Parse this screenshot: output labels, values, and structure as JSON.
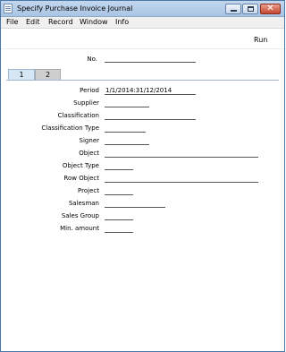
{
  "window": {
    "title": "Specify Purchase Invoice Journal"
  },
  "menu": [
    "File",
    "Edit",
    "Record",
    "Window",
    "Info"
  ],
  "toolbar": {
    "run_label": "Run"
  },
  "header": {
    "no_label": "No.",
    "no_value": ""
  },
  "tabs": [
    "1",
    "2"
  ],
  "fields": {
    "period": {
      "label": "Period",
      "value": "1/1/2014:31/12/2014"
    },
    "supplier": {
      "label": "Supplier",
      "value": ""
    },
    "classification": {
      "label": "Classification",
      "value": ""
    },
    "classification_type": {
      "label": "Classification Type",
      "value": ""
    },
    "signer": {
      "label": "Signer",
      "value": ""
    },
    "object": {
      "label": "Object",
      "value": ""
    },
    "object_type": {
      "label": "Object Type",
      "value": ""
    },
    "row_object": {
      "label": "Row Object",
      "value": ""
    },
    "project": {
      "label": "Project",
      "value": ""
    },
    "salesman": {
      "label": "Salesman",
      "value": ""
    },
    "sales_group": {
      "label": "Sales Group",
      "value": ""
    },
    "min_amount": {
      "label": "Min. amount",
      "value": ""
    }
  }
}
